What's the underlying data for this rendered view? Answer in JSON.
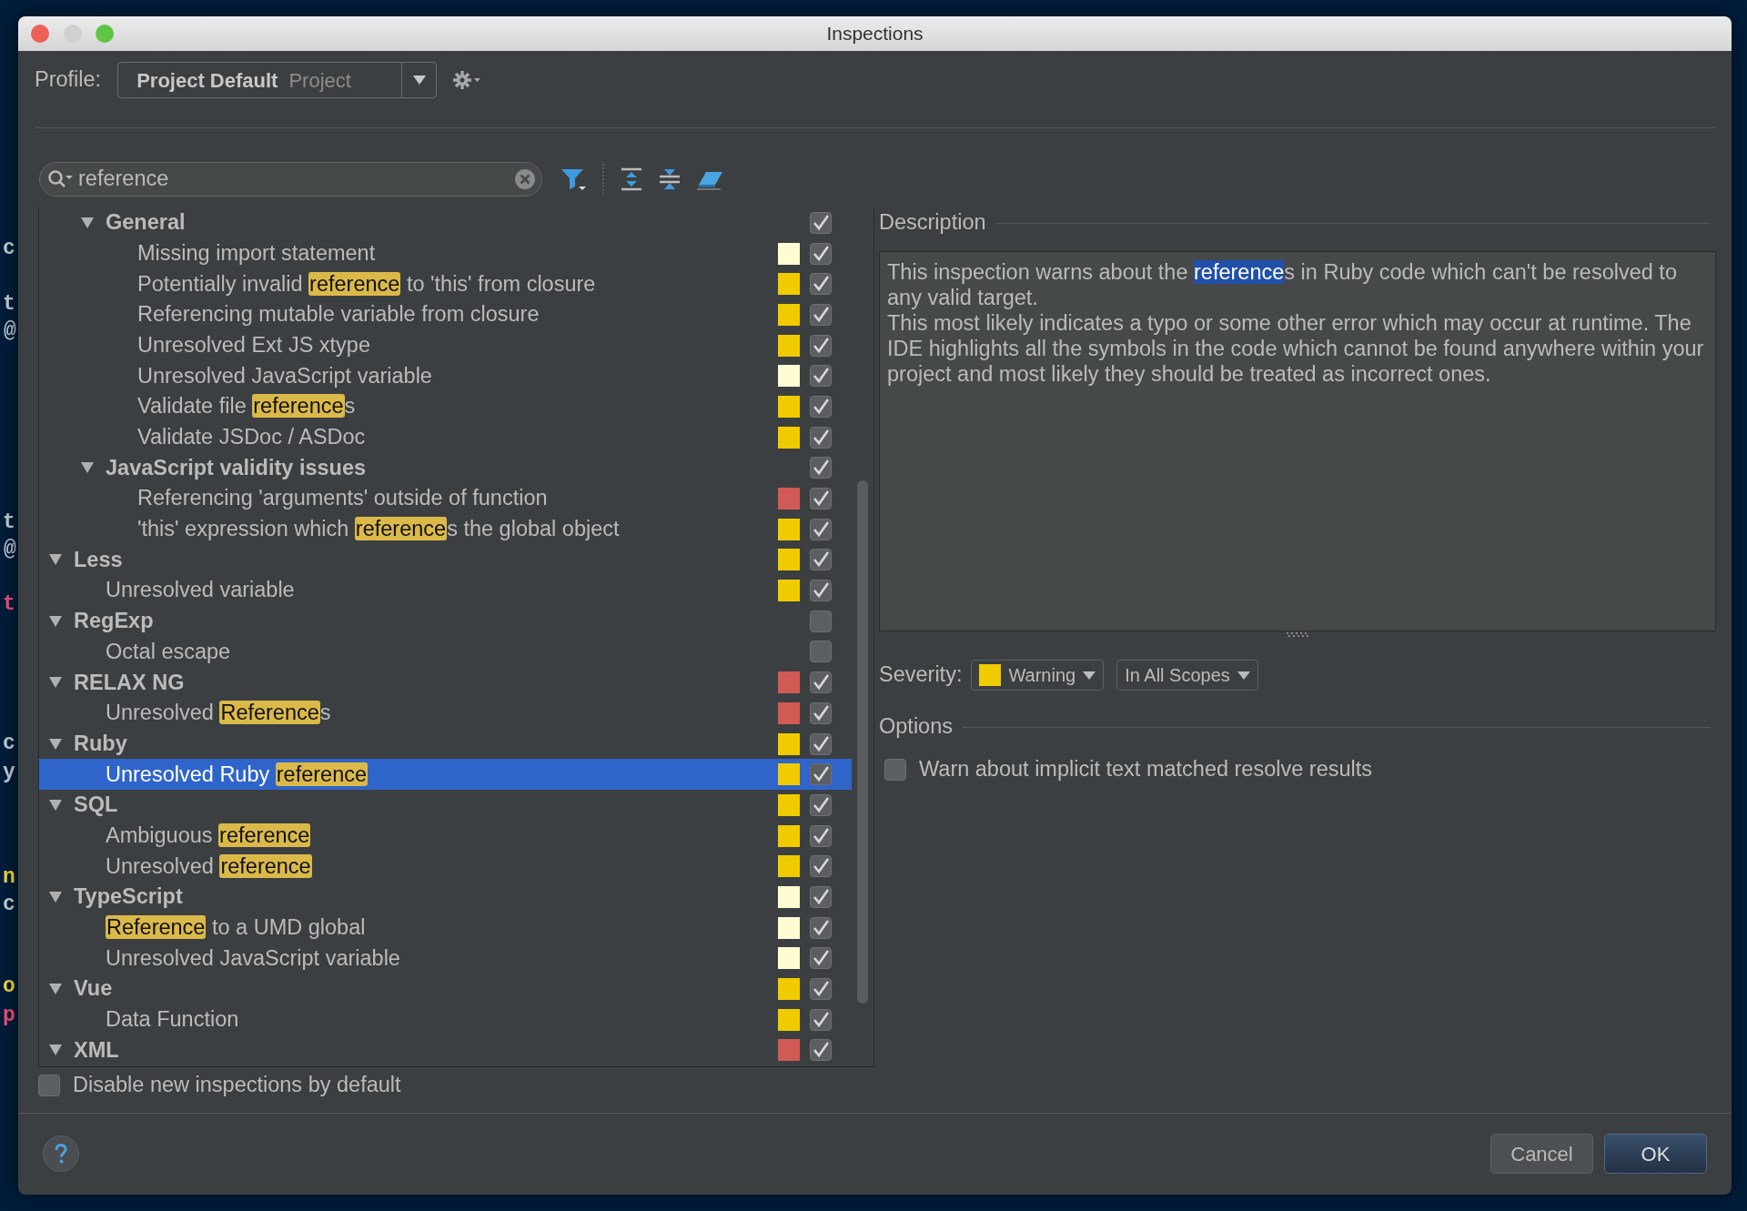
{
  "desktop": {
    "editor_fragments": [
      {
        "text": "c",
        "color": "#c5ccd6"
      },
      {
        "text": "t",
        "color": "#c5ccd6"
      },
      {
        "text": "@",
        "color": "#c5ccd6"
      },
      {
        "text": "t",
        "color": "#c5ccd6"
      },
      {
        "text": "@",
        "color": "#c5ccd6"
      },
      {
        "text": "t",
        "color": "#f0507a"
      },
      {
        "text": "c",
        "color": "#c5ccd6"
      },
      {
        "text": "y",
        "color": "#c5ccd6"
      },
      {
        "text": "n",
        "color": "#f5d63c"
      },
      {
        "text": "c",
        "color": "#c5ccd6"
      },
      {
        "text": "o",
        "color": "#f5d63c"
      },
      {
        "text": "p",
        "color": "#f0507a"
      }
    ]
  },
  "window": {
    "title": "Inspections"
  },
  "profile": {
    "label": "Profile:",
    "name": "Project Default",
    "scope": "Project"
  },
  "search": {
    "value": "reference"
  },
  "tree": {
    "items": [
      {
        "children": [
          {
            "label": "General",
            "expanded": true,
            "checked": true,
            "selected": false,
            "children": [
              {
                "label": "Missing import statement",
                "color": "#fffcd2",
                "checked": true,
                "selected": false
              },
              {
                "label": "Potentially invalid **reference** to 'this' from closure",
                "color": "#f0cb00",
                "checked": true,
                "selected": false
              },
              {
                "label": "Referencing mutable variable from closure",
                "color": "#f0cb00",
                "checked": true,
                "selected": false
              },
              {
                "label": "Unresolved Ext JS xtype",
                "color": "#f0cb00",
                "checked": true,
                "selected": false
              },
              {
                "label": "Unresolved JavaScript variable",
                "color": "#fffcd2",
                "checked": true,
                "selected": false
              },
              {
                "label": "Validate file **reference**s",
                "color": "#f0cb00",
                "checked": true,
                "selected": false
              },
              {
                "label": "Validate JSDoc / ASDoc",
                "color": "#f0cb00",
                "checked": true,
                "selected": false
              }
            ]
          },
          {
            "label": "JavaScript validity issues",
            "expanded": true,
            "checked": true,
            "selected": false,
            "children": [
              {
                "label": "Referencing 'arguments' outside of function",
                "color": "#d25a55",
                "checked": true,
                "selected": false
              },
              {
                "label": "'this' expression which **reference**s the global object",
                "color": "#f0cb00",
                "checked": true,
                "selected": false
              }
            ]
          }
        ]
      },
      {
        "label": "Less",
        "expanded": true,
        "color": "#f0cb00",
        "checked": true,
        "selected": false,
        "children": [
          {
            "label": "Unresolved variable",
            "color": "#f0cb00",
            "checked": true,
            "selected": false
          }
        ]
      },
      {
        "label": "RegExp",
        "expanded": true,
        "checked": false,
        "selected": false,
        "children": [
          {
            "label": "Octal escape",
            "checked": false,
            "selected": false
          }
        ]
      },
      {
        "label": "RELAX NG",
        "expanded": true,
        "color": "#d25a55",
        "checked": true,
        "selected": false,
        "children": [
          {
            "label": "Unresolved **Reference**s",
            "color": "#d25a55",
            "checked": true,
            "selected": false
          }
        ]
      },
      {
        "label": "Ruby",
        "expanded": true,
        "color": "#f0cb00",
        "checked": true,
        "selected": false,
        "children": [
          {
            "label": "Unresolved Ruby **reference**",
            "color": "#f0cb00",
            "checked": true,
            "selected": true
          }
        ]
      },
      {
        "label": "SQL",
        "expanded": true,
        "color": "#f0cb00",
        "checked": true,
        "selected": false,
        "children": [
          {
            "label": "Ambiguous **reference**",
            "color": "#f0cb00",
            "checked": true,
            "selected": false
          },
          {
            "label": "Unresolved **reference**",
            "color": "#f0cb00",
            "checked": true,
            "selected": false
          }
        ]
      },
      {
        "label": "TypeScript",
        "expanded": true,
        "color": "#fffcd2",
        "checked": true,
        "selected": false,
        "children": [
          {
            "label": "**Reference** to a UMD global",
            "color": "#fffcd2",
            "checked": true,
            "selected": false
          },
          {
            "label": "Unresolved JavaScript variable",
            "color": "#fffcd2",
            "checked": true,
            "selected": false
          }
        ]
      },
      {
        "label": "Vue",
        "expanded": true,
        "color": "#f0cb00",
        "checked": true,
        "selected": false,
        "children": [
          {
            "label": "Data Function",
            "color": "#f0cb00",
            "checked": true,
            "selected": false
          }
        ]
      },
      {
        "label": "XML",
        "expanded": true,
        "color": "#d25a55",
        "checked": true,
        "selected": false
      }
    ]
  },
  "disable_new": {
    "label": "Disable new inspections by default",
    "checked": false
  },
  "description": {
    "heading": "Description",
    "paragraphs": [
      "This inspection warns about the **reference**s in Ruby code which can't be resolved to any valid target.",
      "This most likely indicates a typo or some other error which may occur at runtime. The IDE highlights all the symbols in the code which cannot be found anywhere within your project and most likely they should be treated as incorrect ones."
    ]
  },
  "severity": {
    "label": "Severity:",
    "value": "Warning",
    "color": "#f0cb00",
    "scope": "In All Scopes"
  },
  "options": {
    "heading": "Options",
    "items": [
      {
        "label": "Warn about implicit text matched resolve results",
        "checked": false
      }
    ]
  },
  "buttons": [
    {
      "label": "Cancel",
      "kind": "secondary"
    },
    {
      "label": "OK",
      "kind": "default"
    }
  ]
}
